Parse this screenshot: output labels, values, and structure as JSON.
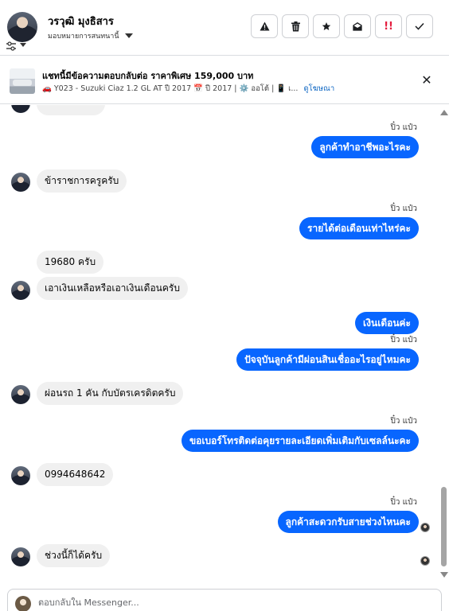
{
  "header": {
    "name": "วรวุฒิ มุงธิสาร",
    "assign_label": "มอบหมายการสนทนานี้",
    "toolbar": [
      {
        "icon": "warning-icon",
        "glyph": "⚠"
      },
      {
        "icon": "trash-icon",
        "glyph": "🗑"
      },
      {
        "icon": "star-icon",
        "glyph": "★"
      },
      {
        "icon": "mark-unread-icon",
        "glyph": "✉"
      },
      {
        "icon": "follow-up-icon",
        "glyph": "!!",
        "color": "#e41e3f"
      },
      {
        "icon": "check-icon",
        "glyph": "✓"
      }
    ]
  },
  "ad": {
    "title": "แชทนี้มีข้อความตอบกลับต่อ ราคาพิเศษ 159,000 บาท",
    "subtitle": "🚗 Y023 - Suzuki Ciaz 1.2 GL AT ปี 2017 📅 ปี 2017 | ⚙️ ออโต้ | 📱 เ...",
    "link": "ดูโฆษณา"
  },
  "messages": [
    {
      "sender": "ปิ๋ว แป๋ว",
      "text": "ลูกค้าทำอาชีพอะไรคะ"
    },
    {
      "text": "ข้าราชการครูครับ"
    },
    {
      "sender": "ปิ๋ว แป๋ว",
      "text": "รายได้ต่อเดือนเท่าไหร่คะ"
    },
    {
      "text": "19680 ครับ"
    },
    {
      "text": "เอาเงินเหลือหรือเอาเงินเดือนครับ"
    },
    {
      "text": "เงินเดือนค่ะ"
    },
    {
      "sender": "ปิ๋ว แป๋ว",
      "text": "ปัจจุบันลูกค้ามีผ่อนสินเชื่ออะไรอยู่ไหมคะ"
    },
    {
      "text": "ผ่อนรถ 1 คัน กับบัตรเครดิตครับ"
    },
    {
      "sender": "ปิ๋ว แป๋ว",
      "text": "ขอเบอร์โทรติดต่อคุยรายละเอียดเพิ่มเติมกับเซลล์นะคะ"
    },
    {
      "text": "0994648642"
    },
    {
      "sender": "ปิ๋ว แป๋ว",
      "text": "ลูกค้าสะดวกรับสายช่วงไหนคะ"
    },
    {
      "text": "ช่วงนี้ก็ได้ครับ"
    }
  ],
  "composer": {
    "placeholder": "ตอบกลับใน Messenger..."
  },
  "colors": {
    "outgoing_bubble": "#0866ff",
    "incoming_bubble": "#f0f0f0",
    "link": "#0a64c2",
    "follow_up": "#e41e3f"
  }
}
